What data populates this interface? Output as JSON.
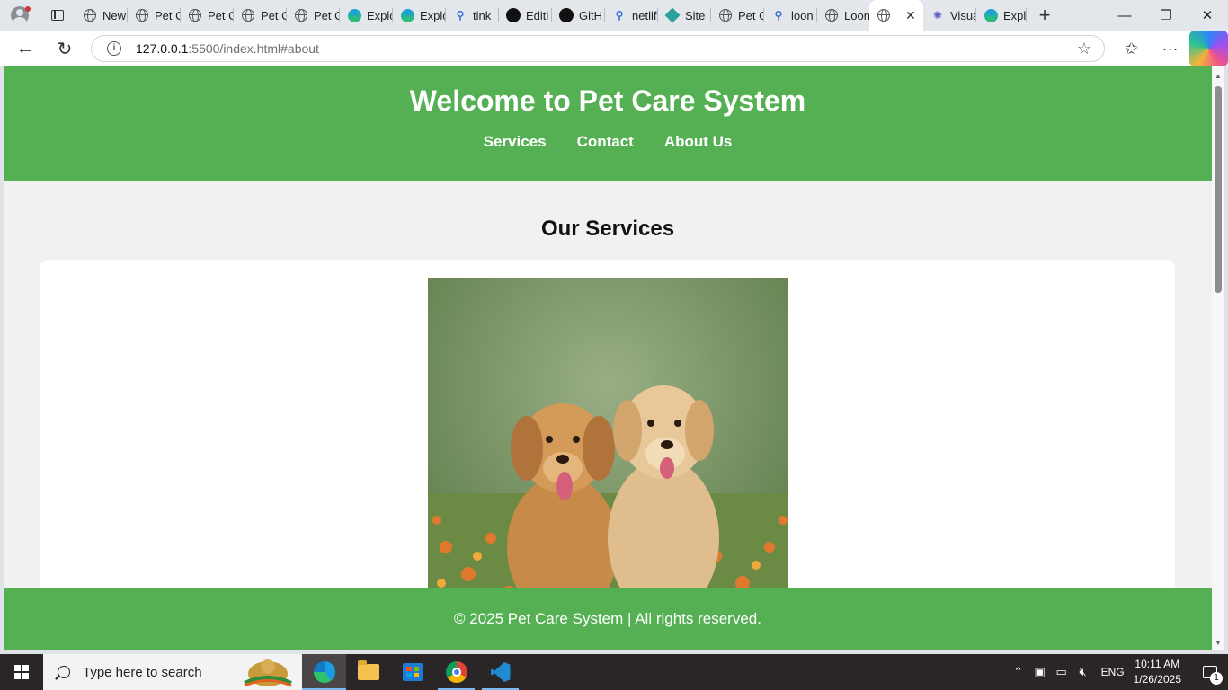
{
  "browser": {
    "tabs": [
      {
        "title": "New",
        "icon": "globe-icon"
      },
      {
        "title": "Pet C",
        "icon": "globe-icon"
      },
      {
        "title": "Pet C",
        "icon": "globe-icon"
      },
      {
        "title": "Pet C",
        "icon": "globe-icon"
      },
      {
        "title": "Pet C",
        "icon": "globe-icon"
      },
      {
        "title": "Explo",
        "icon": "edge-icon"
      },
      {
        "title": "Explo",
        "icon": "edge-icon"
      },
      {
        "title": "tink",
        "icon": "search-icon"
      },
      {
        "title": "Editi",
        "icon": "github-icon"
      },
      {
        "title": "GitH",
        "icon": "github-icon"
      },
      {
        "title": "netlif",
        "icon": "search-icon"
      },
      {
        "title": "Site",
        "icon": "netlify-icon"
      },
      {
        "title": "Pet C",
        "icon": "globe-icon"
      },
      {
        "title": "loon",
        "icon": "search-icon"
      },
      {
        "title": "Loon",
        "icon": "globe-icon"
      },
      {
        "title": "",
        "icon": "globe-icon",
        "active": true
      },
      {
        "title": "Visua",
        "icon": "vscode-icon"
      },
      {
        "title": "Explo",
        "icon": "edge-icon"
      }
    ],
    "url_host": "127.0.0.1",
    "url_path": ":5500/index.html#about"
  },
  "site": {
    "title": "Welcome to Pet Care System",
    "nav": [
      "Services",
      "Contact",
      "About Us"
    ],
    "section_title": "Our Services",
    "footer": "© 2025 Pet Care System | All rights reserved."
  },
  "taskbar": {
    "search_placeholder": "Type here to search",
    "language": "ENG",
    "time": "10:11 AM",
    "date": "1/26/2025",
    "notification_count": "1"
  },
  "colors": {
    "brand_green": "#54b053",
    "page_bg": "#f1f1f1"
  }
}
